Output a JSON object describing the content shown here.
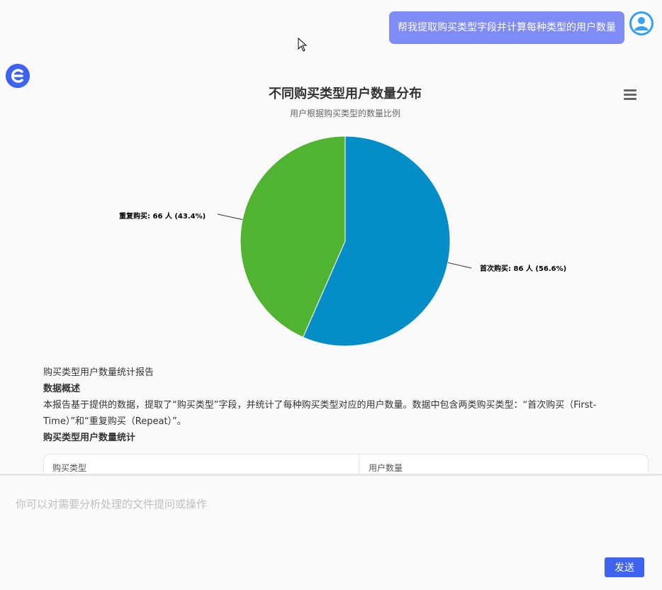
{
  "user_message": "帮我提取购买类型字段并计算每种类型的用户数量",
  "chart_data": {
    "type": "pie",
    "title": "不同购买类型用户数量分布",
    "subtitle": "用户根据购买类型的数量比例",
    "slices": [
      {
        "name": "首次购买",
        "value": 86,
        "percent": 56.6,
        "color": "#058dc7",
        "label": "首次购买: 86 人 (56.6%)"
      },
      {
        "name": "重复购买",
        "value": 66,
        "percent": 43.4,
        "color": "#50b432",
        "label": "重复购买: 66 人 (43.4%)"
      }
    ]
  },
  "report": {
    "heading": "购买类型用户数量统计报告",
    "section1_title": "数据概述",
    "section1_text": "本报告基于提供的数据，提取了“购买类型”字段，并统计了每种购买类型对应的用户数量。数据中包含两类购买类型：“首次购买（First-Time）”和“重复购买（Repeat）”。",
    "section2_title": "购买类型用户数量统计",
    "table_headers": [
      "购买类型",
      "用户数量"
    ]
  },
  "input": {
    "placeholder": "你可以对需要分析处理的文件提问或操作"
  },
  "send_label": "发送",
  "icons": {
    "user_avatar": "user-avatar-icon",
    "bot_logo": "bot-logo-icon",
    "menu": "hamburger-menu-icon",
    "cursor": "mouse-cursor-icon"
  }
}
